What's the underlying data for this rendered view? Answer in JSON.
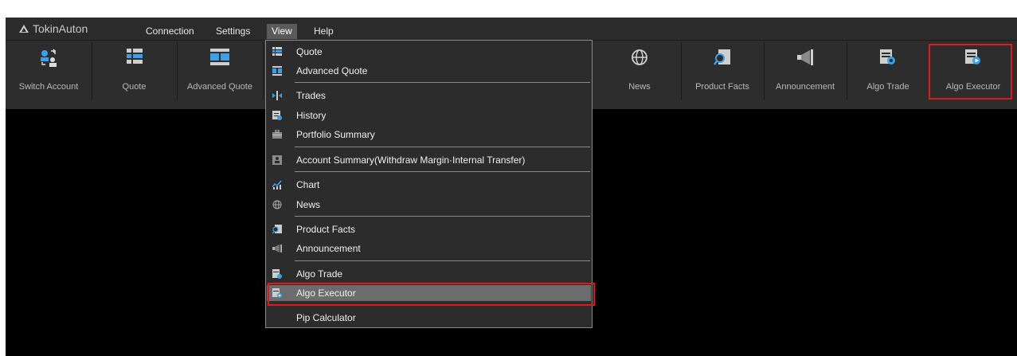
{
  "app": {
    "title": "TokinAuton"
  },
  "menubar": [
    "Connection",
    "Settings",
    "View",
    "Help"
  ],
  "toolbar": [
    {
      "label": "Switch Account",
      "icon": "switch-account-icon"
    },
    {
      "label": "Quote",
      "icon": "quote-icon"
    },
    {
      "label": "Advanced Quote",
      "icon": "advanced-quote-icon"
    },
    {
      "label": "News",
      "icon": "news-icon"
    },
    {
      "label": "Product Facts",
      "icon": "product-facts-icon"
    },
    {
      "label": "Announcement",
      "icon": "announcement-icon"
    },
    {
      "label": "Algo Trade",
      "icon": "algo-trade-icon"
    },
    {
      "label": "Algo Executor",
      "icon": "algo-executor-icon"
    }
  ],
  "view_menu": [
    {
      "label": "Quote",
      "icon": "quote-icon"
    },
    {
      "label": "Advanced Quote",
      "icon": "advanced-quote-icon"
    },
    {
      "label": "Trades",
      "icon": "trades-icon"
    },
    {
      "label": "History",
      "icon": "history-icon"
    },
    {
      "label": "Portfolio Summary",
      "icon": "portfolio-summary-icon"
    },
    {
      "label": "Account Summary(Withdraw Margin·Internal Transfer)",
      "icon": "account-summary-icon"
    },
    {
      "label": "Chart",
      "icon": "chart-icon"
    },
    {
      "label": "News",
      "icon": "news-icon"
    },
    {
      "label": "Product Facts",
      "icon": "product-facts-icon"
    },
    {
      "label": "Announcement",
      "icon": "announcement-icon"
    },
    {
      "label": "Algo Trade",
      "icon": "algo-trade-icon"
    },
    {
      "label": "Algo Executor",
      "icon": "algo-executor-icon",
      "selected": true
    },
    {
      "label": "Pip Calculator",
      "icon": ""
    }
  ],
  "colors": {
    "highlight": "#e01a1a",
    "accent_blue": "#3aa0e8"
  }
}
